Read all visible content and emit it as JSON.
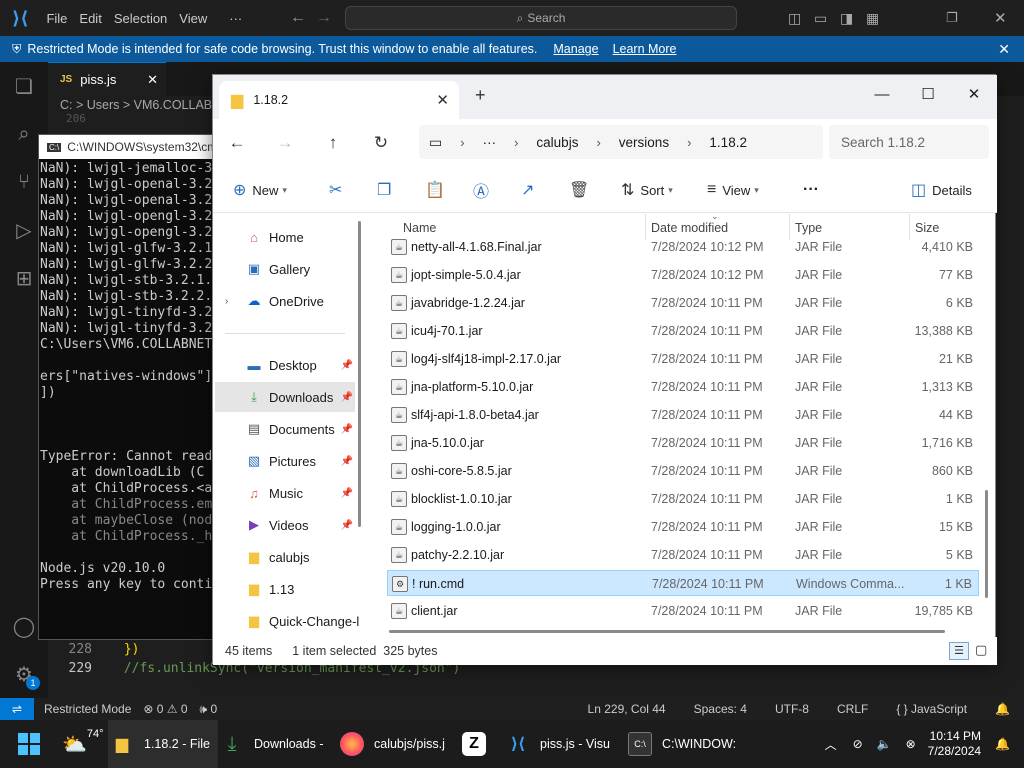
{
  "vscode": {
    "menu": [
      "File",
      "Edit",
      "Selection",
      "View",
      "···"
    ],
    "search_placeholder": "Search",
    "banner_text": "Restricted Mode is intended for safe code browsing. Trust this window to enable all features.",
    "banner_manage": "Manage",
    "banner_learn": "Learn More",
    "tab_icon": "JS",
    "tab_label": "piss.js",
    "breadcrumb": "C: > Users > VM6.COLLAB",
    "line_206": "206",
    "line_228_num": "228",
    "line_228_code": "})",
    "line_229_num": "229",
    "line_229_code": "//fs.unlinkSync(\"version_manifest_v2.json\")",
    "activity_badge": "1"
  },
  "status": {
    "restricted": "Restricted Mode",
    "problems": "⊗ 0 ⚠ 0",
    "ports": "🕪 0",
    "position": "Ln 229, Col 44",
    "spaces": "Spaces: 4",
    "encoding": "UTF-8",
    "eol": "CRLF",
    "language": "{ } JavaScript"
  },
  "cmd": {
    "title": "C:\\WINDOWS\\system32\\cmd",
    "lines": [
      "NaN): lwjgl-jemalloc-3",
      "NaN): lwjgl-openal-3.2",
      "NaN): lwjgl-openal-3.2",
      "NaN): lwjgl-opengl-3.2",
      "NaN): lwjgl-opengl-3.2",
      "NaN): lwjgl-glfw-3.2.1",
      "NaN): lwjgl-glfw-3.2.2",
      "NaN): lwjgl-stb-3.2.1.",
      "NaN): lwjgl-stb-3.2.2.",
      "NaN): lwjgl-tinyfd-3.2",
      "NaN): lwjgl-tinyfd-3.2",
      "C:\\Users\\VM6.COLLABNET",
      "",
      "ers[\"natives-windows\"]",
      "])",
      "",
      "",
      "",
      "TypeError: Cannot read",
      "    at downloadLib (C",
      "    at ChildProcess.<a",
      "    at ChildProcess.em",
      "    at maybeClose (nod",
      "    at ChildProcess._h",
      "",
      "Node.js v20.10.0",
      "Press any key to conti"
    ]
  },
  "explorer": {
    "tab_title": "1.18.2",
    "path": [
      "···",
      "calubjs",
      "versions",
      "1.18.2"
    ],
    "search_placeholder": "Search 1.18.2",
    "toolbar": {
      "new": "New",
      "sort": "Sort",
      "view": "View",
      "more": "···",
      "details": "Details"
    },
    "sidebar": [
      {
        "label": "Home",
        "icon": "home-icon",
        "pinned": false
      },
      {
        "label": "Gallery",
        "icon": "gallery-icon",
        "pinned": false
      },
      {
        "label": "OneDrive",
        "icon": "cloud-icon",
        "pinned": false
      },
      {
        "label": "Desktop",
        "icon": "desktop-icon",
        "pinned": true
      },
      {
        "label": "Downloads",
        "icon": "download-icon",
        "pinned": true
      },
      {
        "label": "Documents",
        "icon": "documents-icon",
        "pinned": true
      },
      {
        "label": "Pictures",
        "icon": "pictures-icon",
        "pinned": true
      },
      {
        "label": "Music",
        "icon": "music-icon",
        "pinned": true
      },
      {
        "label": "Videos",
        "icon": "videos-icon",
        "pinned": true
      },
      {
        "label": "calubjs",
        "icon": "folder-icon",
        "pinned": false
      },
      {
        "label": "1.13",
        "icon": "folder-icon",
        "pinned": false
      },
      {
        "label": "Quick-Change-l",
        "icon": "folder-icon",
        "pinned": false
      }
    ],
    "columns": {
      "name": "Name",
      "date": "Date modified",
      "type": "Type",
      "size": "Size"
    },
    "files": [
      {
        "name": "netty-all-4.1.68.Final.jar",
        "date": "7/28/2024 10:12 PM",
        "type": "JAR File",
        "size": "4,410 KB"
      },
      {
        "name": "jopt-simple-5.0.4.jar",
        "date": "7/28/2024 10:12 PM",
        "type": "JAR File",
        "size": "77 KB"
      },
      {
        "name": "javabridge-1.2.24.jar",
        "date": "7/28/2024 10:11 PM",
        "type": "JAR File",
        "size": "6 KB"
      },
      {
        "name": "icu4j-70.1.jar",
        "date": "7/28/2024 10:11 PM",
        "type": "JAR File",
        "size": "13,388 KB"
      },
      {
        "name": "log4j-slf4j18-impl-2.17.0.jar",
        "date": "7/28/2024 10:11 PM",
        "type": "JAR File",
        "size": "21 KB"
      },
      {
        "name": "jna-platform-5.10.0.jar",
        "date": "7/28/2024 10:11 PM",
        "type": "JAR File",
        "size": "1,313 KB"
      },
      {
        "name": "slf4j-api-1.8.0-beta4.jar",
        "date": "7/28/2024 10:11 PM",
        "type": "JAR File",
        "size": "44 KB"
      },
      {
        "name": "jna-5.10.0.jar",
        "date": "7/28/2024 10:11 PM",
        "type": "JAR File",
        "size": "1,716 KB"
      },
      {
        "name": "oshi-core-5.8.5.jar",
        "date": "7/28/2024 10:11 PM",
        "type": "JAR File",
        "size": "860 KB"
      },
      {
        "name": "blocklist-1.0.10.jar",
        "date": "7/28/2024 10:11 PM",
        "type": "JAR File",
        "size": "1 KB"
      },
      {
        "name": "logging-1.0.0.jar",
        "date": "7/28/2024 10:11 PM",
        "type": "JAR File",
        "size": "15 KB"
      },
      {
        "name": "patchy-2.2.10.jar",
        "date": "7/28/2024 10:11 PM",
        "type": "JAR File",
        "size": "5 KB"
      },
      {
        "name": "! run.cmd",
        "date": "7/28/2024 10:11 PM",
        "type": "Windows Comma...",
        "size": "1 KB",
        "selected": true
      },
      {
        "name": "client.jar",
        "date": "7/28/2024 10:11 PM",
        "type": "JAR File",
        "size": "19,785 KB"
      }
    ],
    "status_count": "45 items",
    "status_selected": "1 item selected  325 bytes"
  },
  "taskbar": {
    "weather": "74°",
    "tasks": [
      "1.18.2 - File",
      "Downloads -",
      "calubjs/piss.j",
      "piss.js - Visu",
      "C:\\WINDOW:"
    ],
    "time": "10:14 PM",
    "date": "7/28/2024"
  }
}
